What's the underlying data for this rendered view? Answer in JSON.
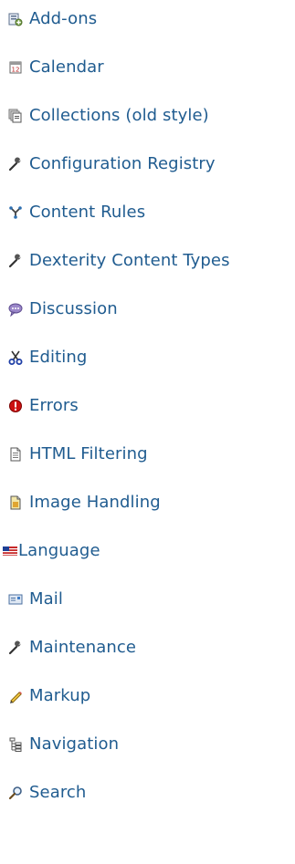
{
  "items": [
    {
      "label": "Add-ons",
      "icon": "addons-icon"
    },
    {
      "label": "Calendar",
      "icon": "calendar-icon"
    },
    {
      "label": "Collections (old style)",
      "icon": "collections-icon"
    },
    {
      "label": "Configuration Registry",
      "icon": "wrench-icon"
    },
    {
      "label": "Content Rules",
      "icon": "content-rules-icon"
    },
    {
      "label": "Dexterity Content Types",
      "icon": "wrench-icon"
    },
    {
      "label": "Discussion",
      "icon": "speech-bubble-icon"
    },
    {
      "label": "Editing",
      "icon": "scissors-icon"
    },
    {
      "label": "Errors",
      "icon": "error-icon"
    },
    {
      "label": "HTML Filtering",
      "icon": "document-icon"
    },
    {
      "label": "Image Handling",
      "icon": "image-icon"
    },
    {
      "label": "Language",
      "icon": "flag-icon"
    },
    {
      "label": "Mail",
      "icon": "mail-icon"
    },
    {
      "label": "Maintenance",
      "icon": "wrench-icon"
    },
    {
      "label": "Markup",
      "icon": "pencil-icon"
    },
    {
      "label": "Navigation",
      "icon": "sitemap-icon"
    },
    {
      "label": "Search",
      "icon": "magnifier-icon"
    }
  ],
  "colors": {
    "link": "#205c90"
  }
}
